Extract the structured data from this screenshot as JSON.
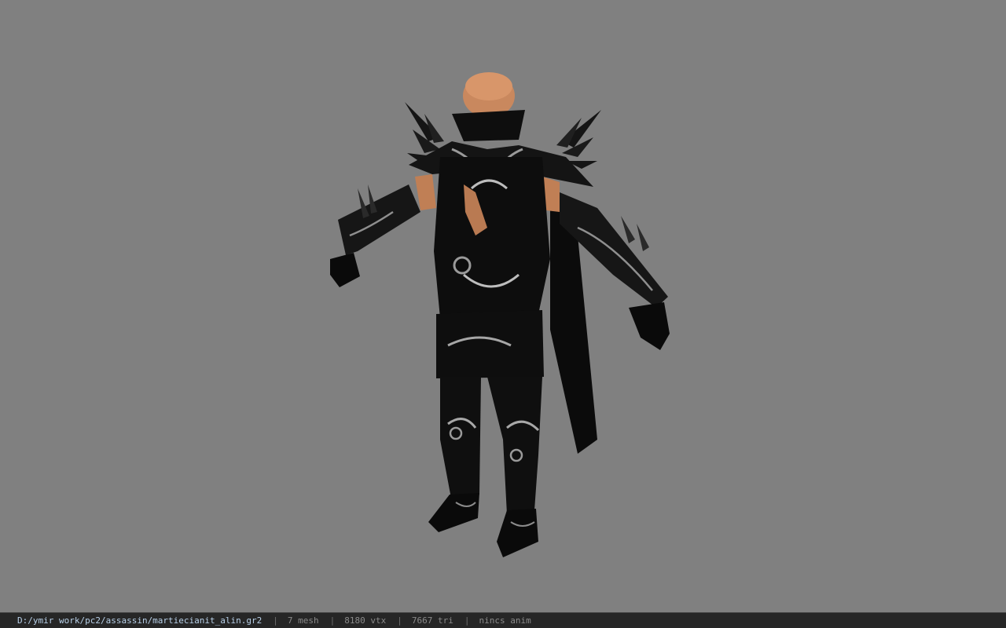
{
  "viewer": {
    "background_color": "#808080",
    "model_icon": "character-model-icon"
  },
  "status_bar": {
    "file_path": "D:/ymir work/pc2/assassin/martiecianit_alin.gr2",
    "separator": "|",
    "mesh_count": "7 mesh",
    "vertex_count": "8180 vtx",
    "triangle_count": "7667 tri",
    "animation_status": "nincs anim"
  }
}
